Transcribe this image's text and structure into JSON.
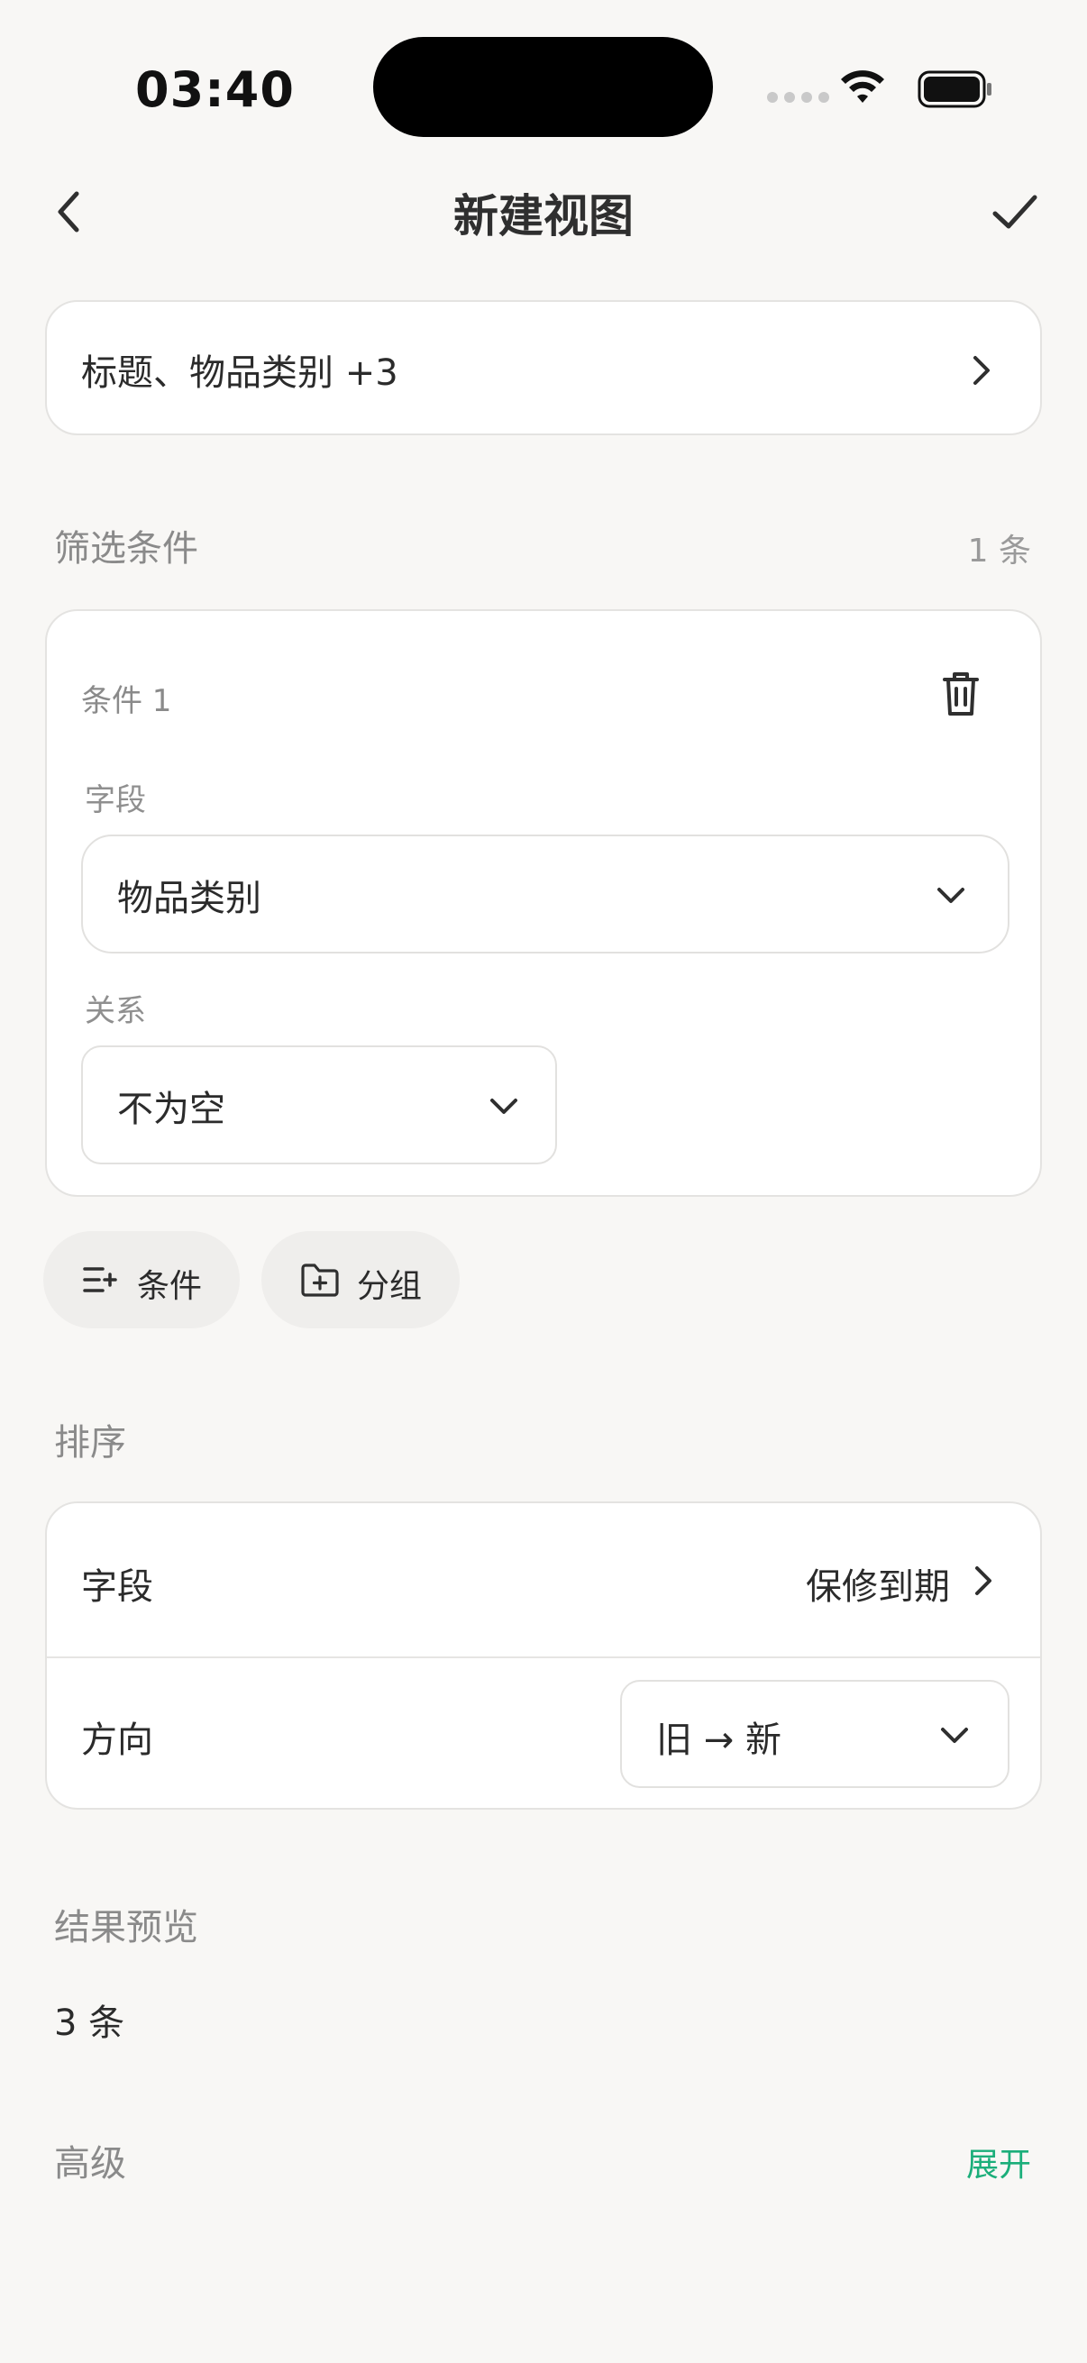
{
  "status_bar": {
    "time": "03:40"
  },
  "nav": {
    "title": "新建视图"
  },
  "fields_summary": {
    "text": "标题、物品类别 +3"
  },
  "filter": {
    "section_label": "筛选条件",
    "count": "1 条",
    "condition": {
      "title": "条件 1",
      "field_label": "字段",
      "field_value": "物品类别",
      "relation_label": "关系",
      "relation_value": "不为空"
    },
    "add_condition_label": "条件",
    "add_group_label": "分组"
  },
  "sort": {
    "section_label": "排序",
    "field_label": "字段",
    "field_value": "保修到期",
    "direction_label": "方向",
    "direction_value": "旧 → 新"
  },
  "preview": {
    "section_label": "结果预览",
    "count": "3 条"
  },
  "advanced": {
    "section_label": "高级",
    "expand_label": "展开"
  },
  "colors": {
    "accent": "#1bae7a",
    "background": "#f8f7f5",
    "card": "#ffffff",
    "muted_text": "#8a8a8a"
  }
}
